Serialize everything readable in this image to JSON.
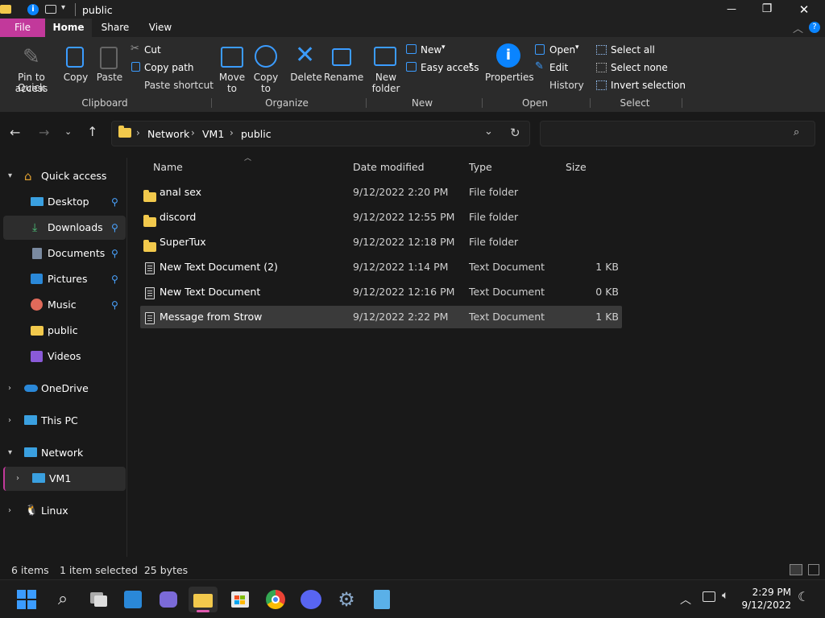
{
  "window": {
    "title": "public",
    "controls": {
      "minimize": "—",
      "maximize": "❐",
      "close": "✕"
    }
  },
  "ribbon_tabs": [
    "File",
    "Home",
    "Share",
    "View"
  ],
  "ribbon": {
    "clipboard": {
      "pin_label_1": "Pin to Quick",
      "pin_label_2": "access",
      "copy": "Copy",
      "paste": "Paste",
      "cut": "Cut",
      "copy_path": "Copy path",
      "paste_shortcut": "Paste shortcut",
      "group": "Clipboard"
    },
    "organize": {
      "move_to_1": "Move",
      "move_to_2": "to",
      "copy_to_1": "Copy",
      "copy_to_2": "to",
      "delete": "Delete",
      "rename": "Rename",
      "group": "Organize"
    },
    "new": {
      "new_folder_1": "New",
      "new_folder_2": "folder",
      "new_item": "New",
      "easy_access": "Easy access",
      "group": "New"
    },
    "open": {
      "properties": "Properties",
      "open": "Open",
      "edit": "Edit",
      "history": "History",
      "group": "Open"
    },
    "select": {
      "select_all": "Select all",
      "select_none": "Select none",
      "invert": "Invert selection",
      "group": "Select"
    }
  },
  "address": {
    "crumbs": [
      "Network",
      "VM1",
      "public"
    ],
    "search_placeholder": ""
  },
  "sidebar": {
    "quick_access": "Quick access",
    "items": [
      {
        "label": "Desktop",
        "icon": "desktop-icon",
        "pinned": true
      },
      {
        "label": "Downloads",
        "icon": "downloads-icon",
        "pinned": true
      },
      {
        "label": "Documents",
        "icon": "documents-icon",
        "pinned": true
      },
      {
        "label": "Pictures",
        "icon": "pictures-icon",
        "pinned": true
      },
      {
        "label": "Music",
        "icon": "music-icon",
        "pinned": true
      },
      {
        "label": "public",
        "icon": "folder-icon",
        "pinned": false
      },
      {
        "label": "Videos",
        "icon": "videos-icon",
        "pinned": false
      }
    ],
    "onedrive": "OneDrive",
    "this_pc": "This PC",
    "network": "Network",
    "vm1": "VM1",
    "linux": "Linux"
  },
  "columns": {
    "name": "Name",
    "date": "Date modified",
    "type": "Type",
    "size": "Size"
  },
  "files": [
    {
      "name": "anal sex",
      "date": "9/12/2022 2:20 PM",
      "type": "File folder",
      "size": "",
      "kind": "folder"
    },
    {
      "name": "discord",
      "date": "9/12/2022 12:55 PM",
      "type": "File folder",
      "size": "",
      "kind": "folder"
    },
    {
      "name": "SuperTux",
      "date": "9/12/2022 12:18 PM",
      "type": "File folder",
      "size": "",
      "kind": "folder"
    },
    {
      "name": "New Text Document (2)",
      "date": "9/12/2022 1:14 PM",
      "type": "Text Document",
      "size": "1 KB",
      "kind": "doc"
    },
    {
      "name": "New Text Document",
      "date": "9/12/2022 12:16 PM",
      "type": "Text Document",
      "size": "0 KB",
      "kind": "doc"
    },
    {
      "name": "Message from Strow",
      "date": "9/12/2022 2:22 PM",
      "type": "Text Document",
      "size": "1 KB",
      "kind": "doc"
    }
  ],
  "status": {
    "count": "6 items",
    "selection": "1 item selected  25 bytes"
  },
  "clock": {
    "time": "2:29 PM",
    "date": "9/12/2022"
  },
  "colors": {
    "accent": "#0078d4",
    "file_tab": "#c2399b",
    "folder": "#f2c94c"
  }
}
